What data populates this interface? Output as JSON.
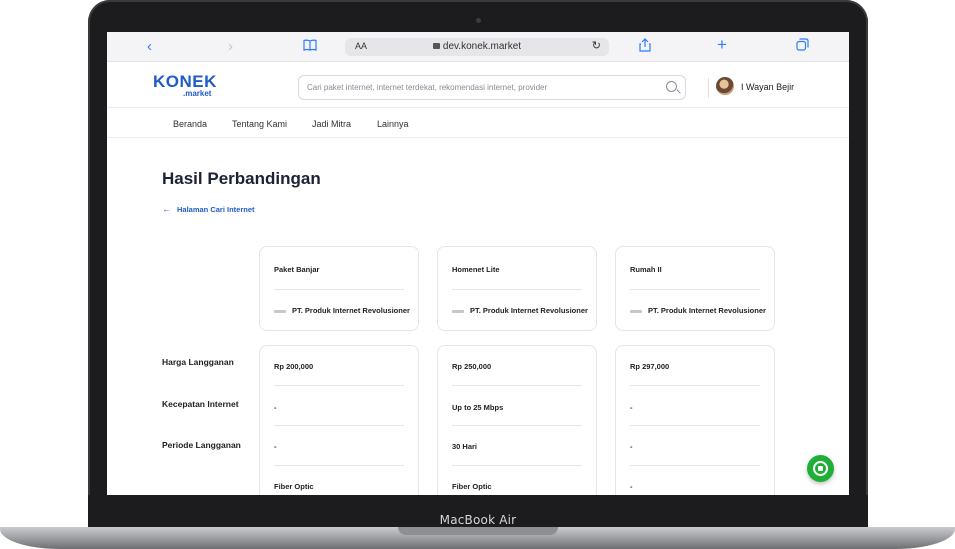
{
  "device": {
    "label": "MacBook Air"
  },
  "browser": {
    "text_size_label": "AA",
    "url": "dev.konek.market",
    "icons": {
      "back": "chevron-left-icon",
      "forward": "chevron-right-icon",
      "bookmarks": "book-icon",
      "reload": "reload-icon",
      "share": "share-icon",
      "new_tab": "plus-icon",
      "tabs": "tabs-icon"
    }
  },
  "header": {
    "logo_main": "KONEK",
    "logo_sub": ".market",
    "search_placeholder": "Cari paket internet, internet terdekat, rekomendasi internet, provider",
    "user_name": "I Wayan Bejir"
  },
  "nav": {
    "items": [
      "Beranda",
      "Tentang Kami",
      "Jadi Mitra",
      "Lainnya"
    ]
  },
  "page": {
    "title": "Hasil Perbandingan",
    "back_link": "Halaman Cari Internet"
  },
  "comparison": {
    "row_labels": [
      "Harga Langganan",
      "Kecepatan Internet",
      "Periode Langganan"
    ],
    "plans": [
      {
        "name": "Paket Banjar",
        "provider": "PT. Produk Internet Revolusioner",
        "price": "Rp 200,000",
        "speed": "-",
        "period": "-",
        "type": "Fiber Optic"
      },
      {
        "name": "Homenet Lite",
        "provider": "PT. Produk Internet Revolusioner",
        "price": "Rp 250,000",
        "speed": "Up to 25 Mbps",
        "period": "30 Hari",
        "type": "Fiber Optic"
      },
      {
        "name": "Rumah II",
        "provider": "PT. Produk Internet Revolusioner",
        "price": "Rp 297,000",
        "speed": "-",
        "period": "-",
        "type": "-"
      }
    ]
  },
  "floating": {
    "whatsapp_icon": "whatsapp-icon"
  },
  "colors": {
    "accent": "#1f5cc8",
    "whatsapp": "#1faf38",
    "browser_icon": "#2f7cf6"
  }
}
